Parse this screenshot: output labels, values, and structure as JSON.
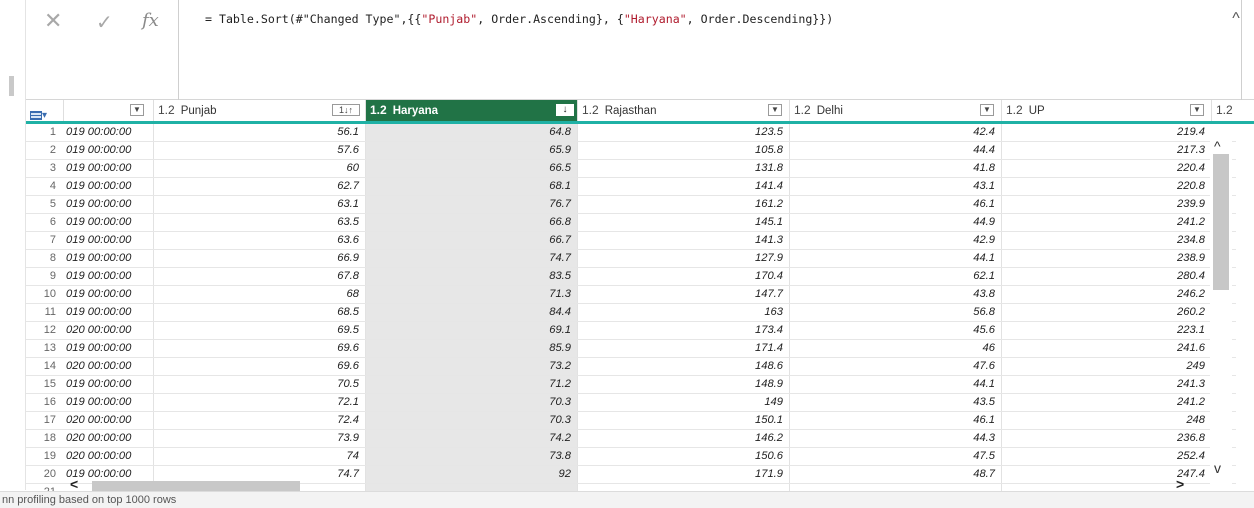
{
  "formula_bar": {
    "cancel_icon": "✕",
    "commit_icon": "✓",
    "fx_label": "fx",
    "formula_prefix": "= Table.Sort(#\"Changed Type\",{{",
    "formula_str1": "\"Punjab\"",
    "formula_mid": ", Order.Ascending}, {",
    "formula_str2": "\"Haryana\"",
    "formula_suffix": ", Order.Descending}})",
    "collapse_icon": "^"
  },
  "grid": {
    "columns": [
      {
        "type": "1.2",
        "name": "Punjab",
        "sort_icon": "1↓↑"
      },
      {
        "type": "1.2",
        "name": "Haryana",
        "sort_icon": "↓"
      },
      {
        "type": "1.2",
        "name": "Rajasthan"
      },
      {
        "type": "1.2",
        "name": "Delhi"
      },
      {
        "type": "1.2",
        "name": "UP"
      },
      {
        "type": "1.2",
        "name": ""
      }
    ],
    "rows": [
      {
        "idx": "1",
        "date": "019 00:00:00",
        "punjab": "56.1",
        "haryana": "64.8",
        "rajasthan": "123.5",
        "delhi": "42.4",
        "up": "219.4"
      },
      {
        "idx": "2",
        "date": "019 00:00:00",
        "punjab": "57.6",
        "haryana": "65.9",
        "rajasthan": "105.8",
        "delhi": "44.4",
        "up": "217.3"
      },
      {
        "idx": "3",
        "date": "019 00:00:00",
        "punjab": "60",
        "haryana": "66.5",
        "rajasthan": "131.8",
        "delhi": "41.8",
        "up": "220.4"
      },
      {
        "idx": "4",
        "date": "019 00:00:00",
        "punjab": "62.7",
        "haryana": "68.1",
        "rajasthan": "141.4",
        "delhi": "43.1",
        "up": "220.8"
      },
      {
        "idx": "5",
        "date": "019 00:00:00",
        "punjab": "63.1",
        "haryana": "76.7",
        "rajasthan": "161.2",
        "delhi": "46.1",
        "up": "239.9"
      },
      {
        "idx": "6",
        "date": "019 00:00:00",
        "punjab": "63.5",
        "haryana": "66.8",
        "rajasthan": "145.1",
        "delhi": "44.9",
        "up": "241.2"
      },
      {
        "idx": "7",
        "date": "019 00:00:00",
        "punjab": "63.6",
        "haryana": "66.7",
        "rajasthan": "141.3",
        "delhi": "42.9",
        "up": "234.8"
      },
      {
        "idx": "8",
        "date": "019 00:00:00",
        "punjab": "66.9",
        "haryana": "74.7",
        "rajasthan": "127.9",
        "delhi": "44.1",
        "up": "238.9"
      },
      {
        "idx": "9",
        "date": "019 00:00:00",
        "punjab": "67.8",
        "haryana": "83.5",
        "rajasthan": "170.4",
        "delhi": "62.1",
        "up": "280.4"
      },
      {
        "idx": "10",
        "date": "019 00:00:00",
        "punjab": "68",
        "haryana": "71.3",
        "rajasthan": "147.7",
        "delhi": "43.8",
        "up": "246.2"
      },
      {
        "idx": "11",
        "date": "019 00:00:00",
        "punjab": "68.5",
        "haryana": "84.4",
        "rajasthan": "163",
        "delhi": "56.8",
        "up": "260.2"
      },
      {
        "idx": "12",
        "date": "020 00:00:00",
        "punjab": "69.5",
        "haryana": "69.1",
        "rajasthan": "173.4",
        "delhi": "45.6",
        "up": "223.1"
      },
      {
        "idx": "13",
        "date": "019 00:00:00",
        "punjab": "69.6",
        "haryana": "85.9",
        "rajasthan": "171.4",
        "delhi": "46",
        "up": "241.6"
      },
      {
        "idx": "14",
        "date": "020 00:00:00",
        "punjab": "69.6",
        "haryana": "73.2",
        "rajasthan": "148.6",
        "delhi": "47.6",
        "up": "249"
      },
      {
        "idx": "15",
        "date": "019 00:00:00",
        "punjab": "70.5",
        "haryana": "71.2",
        "rajasthan": "148.9",
        "delhi": "44.1",
        "up": "241.3"
      },
      {
        "idx": "16",
        "date": "019 00:00:00",
        "punjab": "72.1",
        "haryana": "70.3",
        "rajasthan": "149",
        "delhi": "43.5",
        "up": "241.2"
      },
      {
        "idx": "17",
        "date": "020 00:00:00",
        "punjab": "72.4",
        "haryana": "70.3",
        "rajasthan": "150.1",
        "delhi": "46.1",
        "up": "248"
      },
      {
        "idx": "18",
        "date": "020 00:00:00",
        "punjab": "73.9",
        "haryana": "74.2",
        "rajasthan": "146.2",
        "delhi": "44.3",
        "up": "236.8"
      },
      {
        "idx": "19",
        "date": "020 00:00:00",
        "punjab": "74",
        "haryana": "73.8",
        "rajasthan": "150.6",
        "delhi": "47.5",
        "up": "252.4"
      },
      {
        "idx": "20",
        "date": "019 00:00:00",
        "punjab": "74.7",
        "haryana": "92",
        "rajasthan": "171.9",
        "delhi": "48.7",
        "up": "247.4"
      },
      {
        "idx": "21",
        "date": "",
        "punjab": "",
        "haryana": "",
        "rajasthan": "",
        "delhi": "",
        "up": ""
      }
    ]
  },
  "scroll": {
    "up_icon": "^",
    "down_icon": "v",
    "left_icon": "<",
    "right_icon": ">"
  },
  "status": {
    "text": "nn profiling based on top 1000 rows"
  },
  "colors": {
    "accent": "#1fb1a5",
    "selected_header": "#217346",
    "string_literal": "#b01c2e"
  }
}
